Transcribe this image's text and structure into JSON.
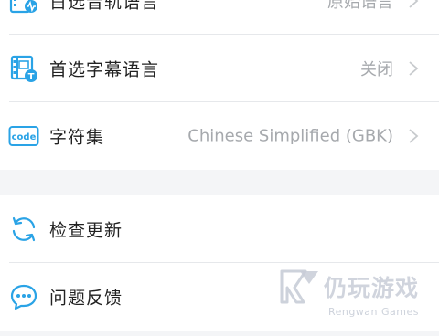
{
  "settings": {
    "rows_top": [
      {
        "label": "首选音轨语言",
        "value": "原始语言",
        "icon": "audio-track-icon"
      },
      {
        "label": "首选字幕语言",
        "value": "关闭",
        "icon": "subtitle-icon"
      },
      {
        "label": "字符集",
        "value": "Chinese Simplified (GBK)",
        "icon": "code-icon",
        "icon_text": "code"
      }
    ],
    "rows_bottom": [
      {
        "label": "检查更新",
        "icon": "refresh-icon"
      },
      {
        "label": "问题反馈",
        "icon": "chat-icon"
      }
    ]
  },
  "watermark": {
    "name": "仍玩游戏",
    "sub": "Rengwan Games"
  },
  "colors": {
    "accent": "#2aa3e6",
    "text": "#222222",
    "secondary_text": "#a6a9ad",
    "background": "#f4f5f7"
  }
}
